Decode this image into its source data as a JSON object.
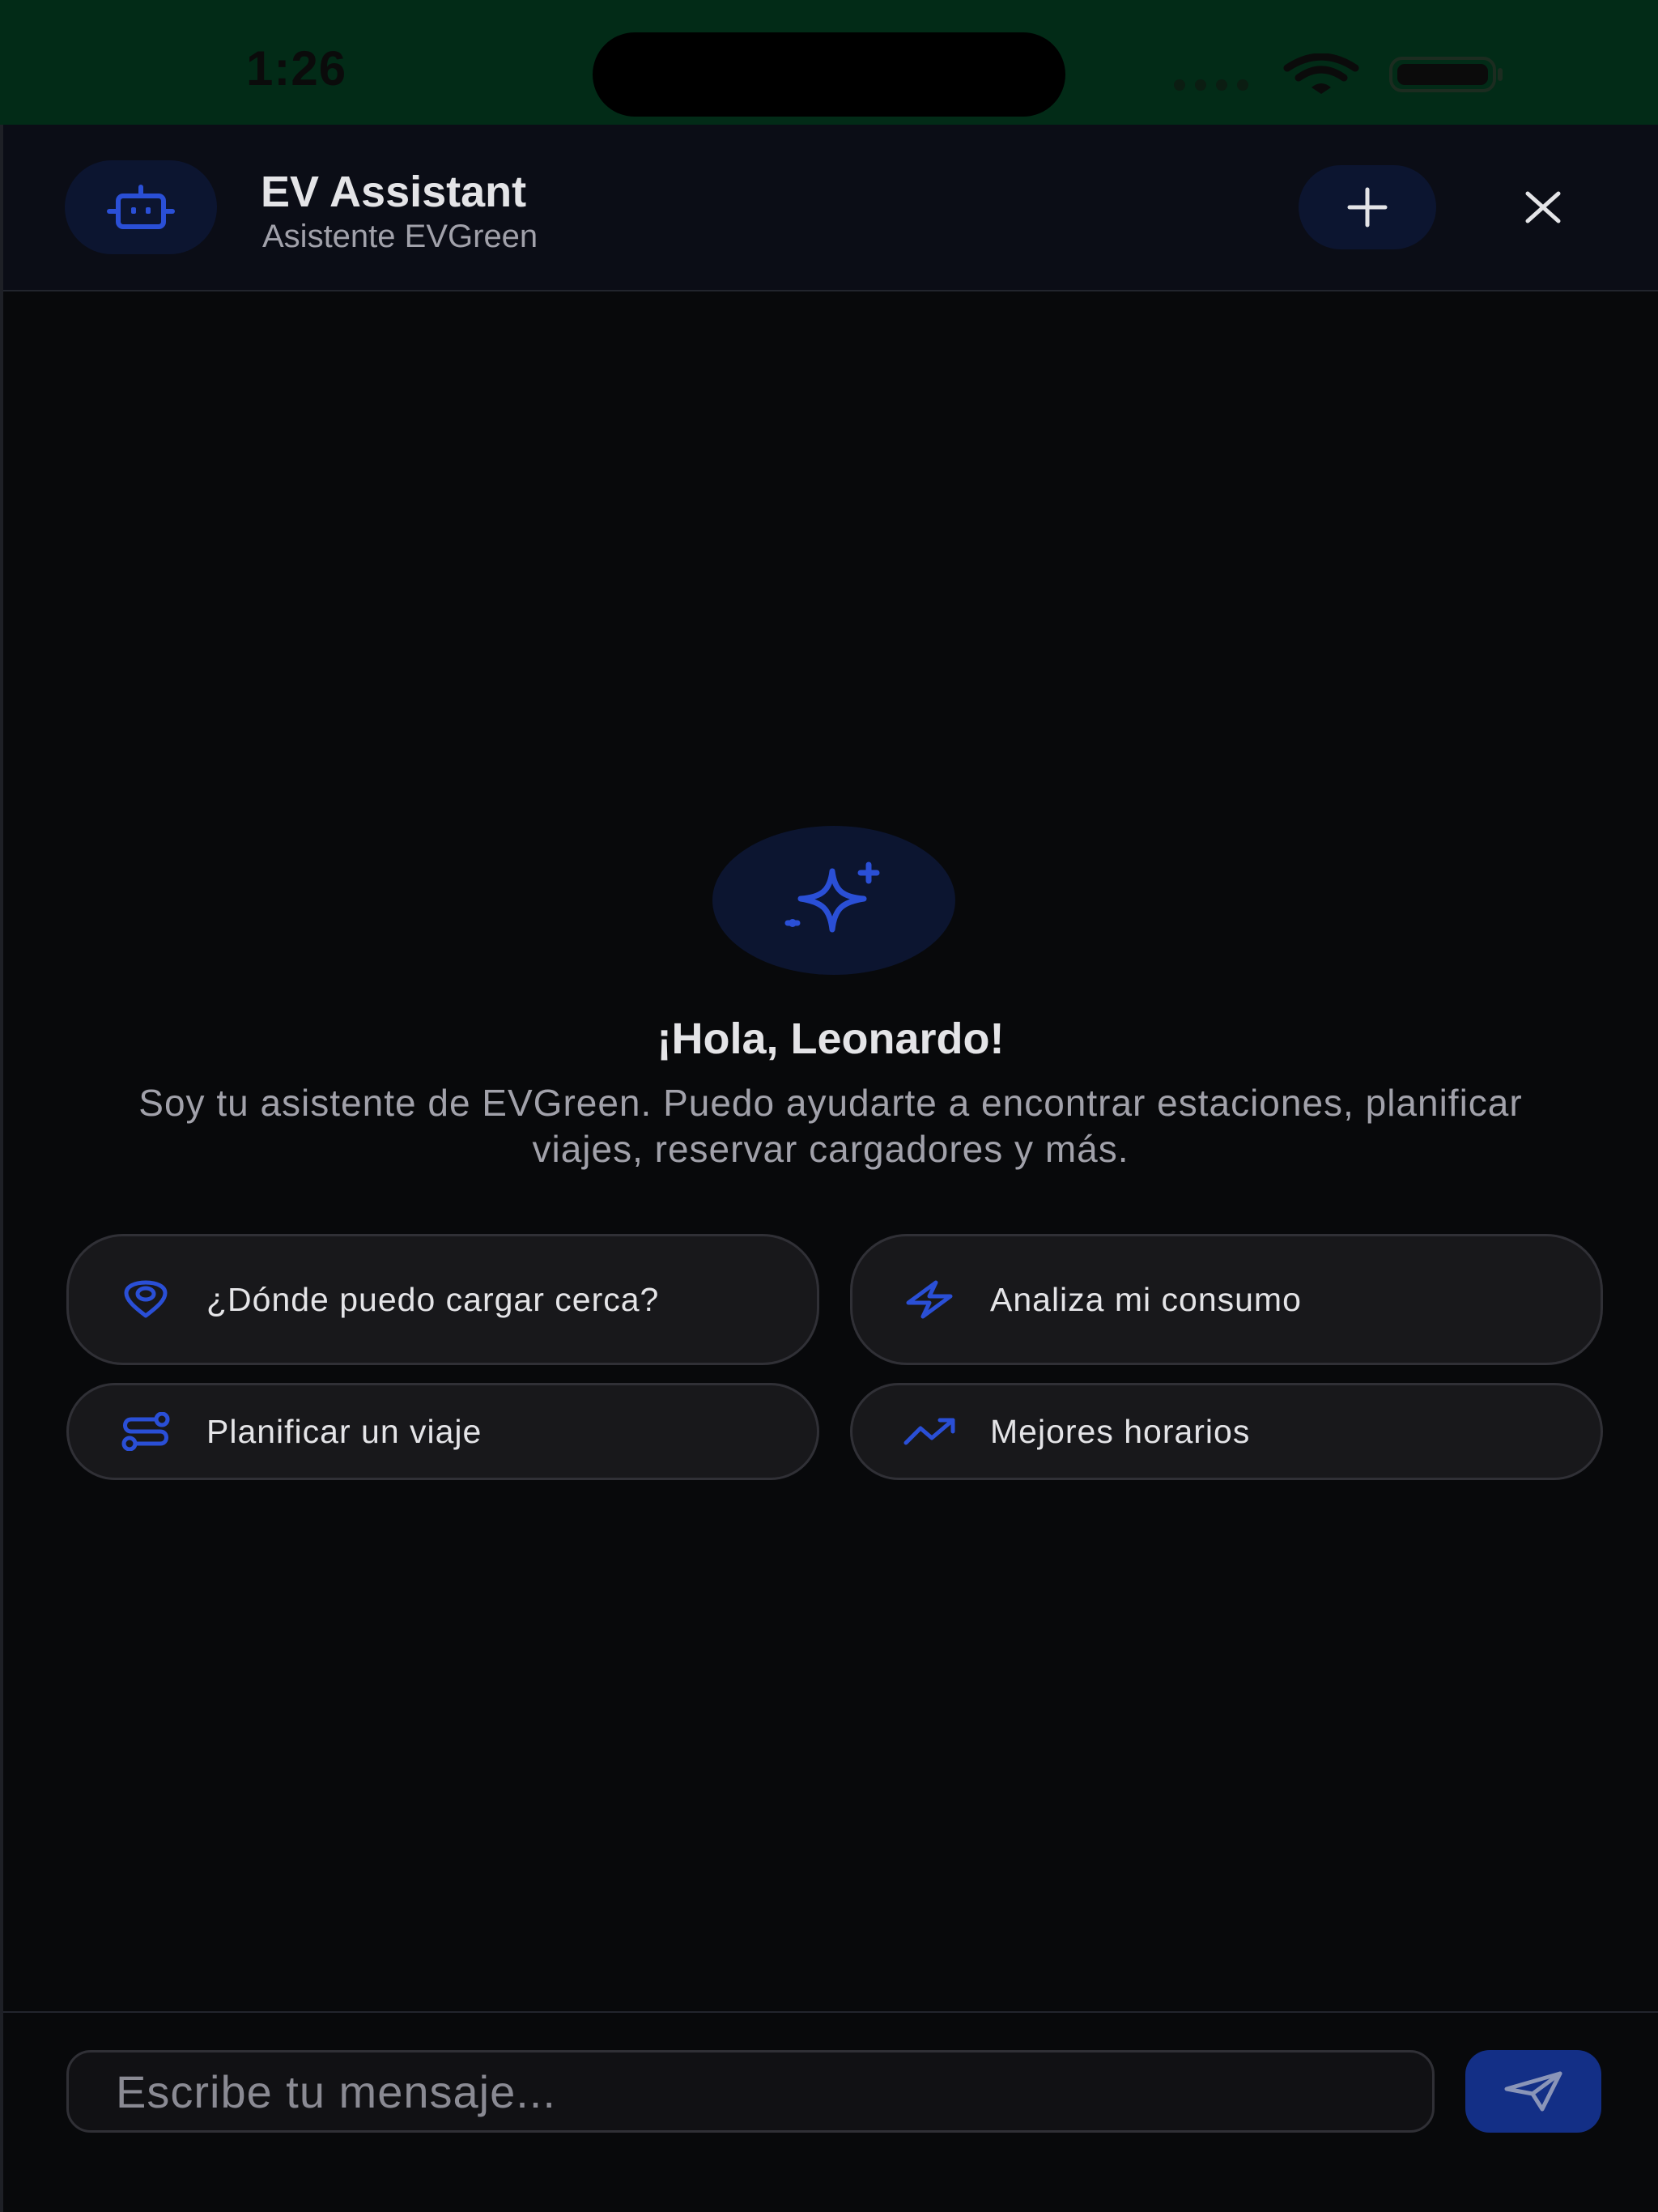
{
  "status_bar": {
    "time": "1:26",
    "icons": [
      "signal-dots-icon",
      "wifi-icon",
      "battery-icon"
    ]
  },
  "header": {
    "title": "EV Assistant",
    "subtitle": "Asistente EVGreen",
    "avatar_icon": "bot-icon",
    "actions": {
      "new_chat_icon": "plus-icon",
      "close_icon": "close-icon"
    }
  },
  "welcome": {
    "hero_icon": "sparkles-icon",
    "greeting": "¡Hola, Leonardo!",
    "intro": "Soy tu asistente de EVGreen. Puedo ayudarte a encontrar estaciones, planificar viajes, reservar cargadores y más."
  },
  "suggestions": [
    {
      "label": "¿Dónde puedo cargar cerca?",
      "icon": "map-pin-icon"
    },
    {
      "label": "Analiza mi consumo",
      "icon": "lightning-icon"
    },
    {
      "label": "Planificar un viaje",
      "icon": "route-icon"
    },
    {
      "label": "Mejores horarios",
      "icon": "trending-up-icon"
    }
  ],
  "composer": {
    "placeholder": "Escribe tu mensaje...",
    "value": "",
    "send_icon": "send-icon"
  },
  "colors": {
    "status_bar_bg": "#022b17",
    "background": "#08090b",
    "header_bg": "#0b0d16",
    "accent": "#2a4fd6",
    "accent_soft": "#0c1530",
    "send_button": "#132f86",
    "chip_bg": "#18181b",
    "chip_border": "#303036",
    "text_primary": "#e4e4e7",
    "text_secondary": "#a1a1aa"
  }
}
